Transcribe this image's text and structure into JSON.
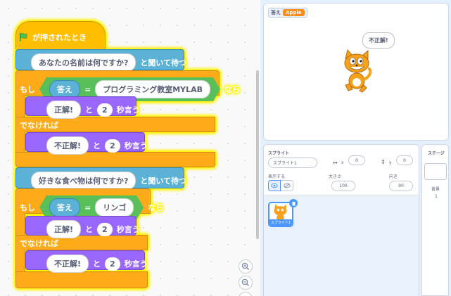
{
  "code": {
    "hat_label": "が押されたとき",
    "ask1": {
      "question": "あなたの名前は何ですか?",
      "suffix": "と聞いて待つ"
    },
    "if1": {
      "if_label": "もし",
      "answer": "答え",
      "equals": "=",
      "value": "プログラミング教室MYLAB",
      "then_label": "なら",
      "say_correct": {
        "text": "正解!",
        "mid": "と",
        "secs": "2",
        "suffix": "秒言う"
      },
      "else_label": "でなければ",
      "say_wrong": {
        "text": "不正解!",
        "mid": "と",
        "secs": "2",
        "suffix": "秒言う"
      }
    },
    "ask2": {
      "question": "好きな食べ物は何ですか?",
      "suffix": "と聞いて待つ"
    },
    "if2": {
      "if_label": "もし",
      "answer": "答え",
      "equals": "=",
      "value": "リンゴ",
      "then_label": "なら",
      "say_correct": {
        "text": "正解!",
        "mid": "と",
        "secs": "2",
        "suffix": "秒言う"
      },
      "else_label": "でなければ",
      "say_wrong": {
        "text": "不正解!",
        "mid": "と",
        "secs": "2",
        "suffix": "秒言う"
      }
    }
  },
  "stage": {
    "monitor_label": "答え",
    "monitor_value": "Apple",
    "speech": "不正解!"
  },
  "sprite_panel": {
    "title": "スプライト",
    "name": "スプライト1",
    "x_label": "x",
    "x_value": "0",
    "y_label": "y",
    "y_value": "0",
    "show_label": "表示する",
    "size_label": "大きさ",
    "size_value": "100",
    "direction_label": "向き",
    "direction_value": "90",
    "thumb_caption": "スプライト1"
  },
  "stage_panel": {
    "title": "ステージ",
    "backdrop_label": "背景",
    "backdrop_count": "1"
  },
  "colors": {
    "events": "#ffbf00",
    "control": "#ffab19",
    "sensing": "#5cb1d6",
    "looks": "#9966ff",
    "operators": "#59c059",
    "accent": "#4c97ff"
  }
}
